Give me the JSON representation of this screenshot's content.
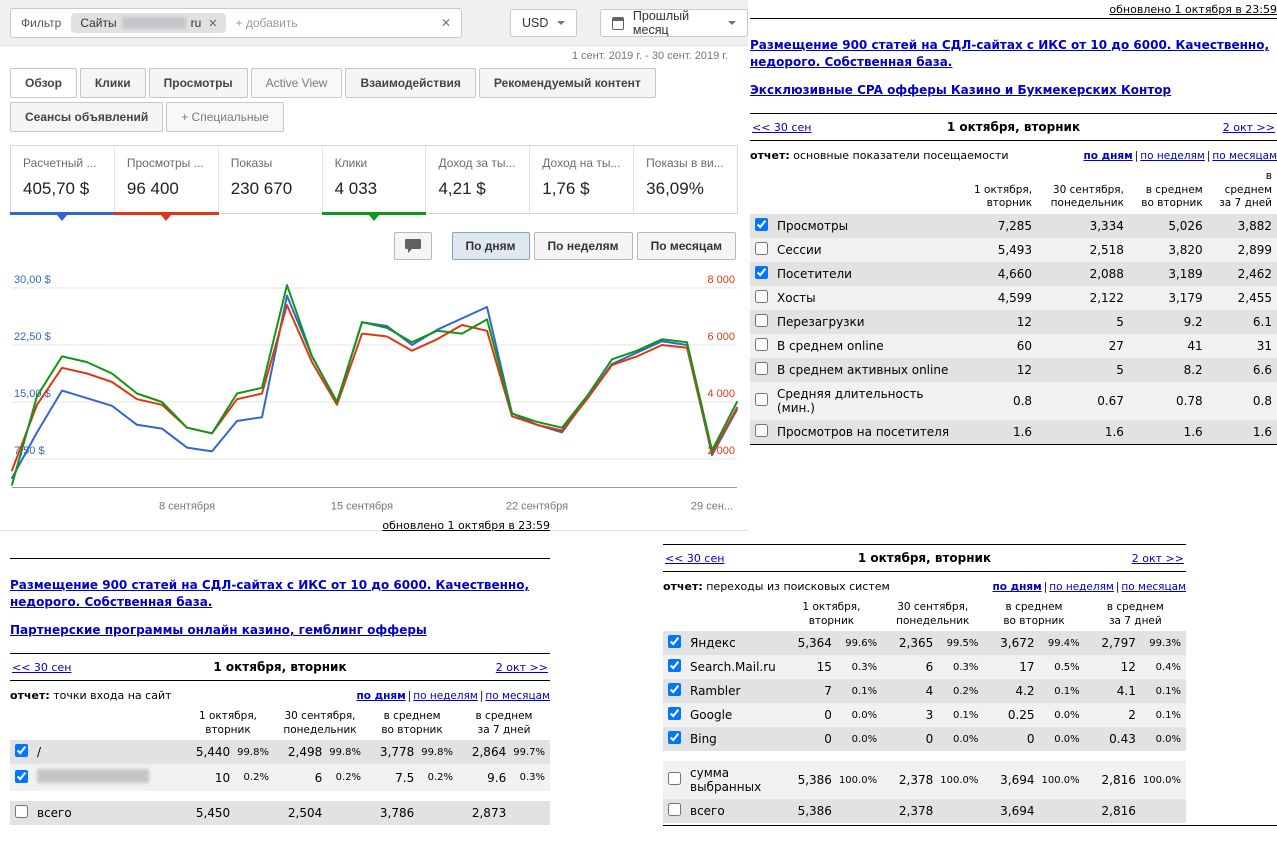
{
  "adsense": {
    "filter_label": "Фильтр",
    "chip_prefix": "Сайты",
    "chip_suffix": "ru",
    "chip_remove": "✕",
    "add_placeholder": "+ добавить",
    "clear_icon": "✕",
    "currency": "USD",
    "period": "Прошлый месяц",
    "date_range": "1 сент. 2019 г. - 30 сент. 2019 г.",
    "tabs_row1": [
      {
        "label": "Обзор",
        "selected": true
      },
      {
        "label": "Клики"
      },
      {
        "label": "Просмотры"
      },
      {
        "label": "Active View",
        "muted": true
      },
      {
        "label": "Взаимодействия"
      },
      {
        "label": "Рекомендуемый контент"
      }
    ],
    "tabs_row2": [
      {
        "label": "Сеансы объявлений"
      },
      {
        "label": "+ Специальные",
        "muted": true
      }
    ],
    "metrics": [
      {
        "label": "Расчетный ...",
        "value": "405,70 $",
        "accent": "#3366cc"
      },
      {
        "label": "Просмотры ...",
        "value": "96 400",
        "accent": "#dc3912"
      },
      {
        "label": "Показы",
        "value": "230 670"
      },
      {
        "label": "Клики",
        "value": "4 033",
        "accent": "#109618"
      },
      {
        "label": "Доход за ты...",
        "value": "4,21 $"
      },
      {
        "label": "Доход на ты...",
        "value": "1,76 $"
      },
      {
        "label": "Показы в ви...",
        "value": "36,09%"
      }
    ],
    "view_buttons": [
      {
        "label": "По дням",
        "selected": true
      },
      {
        "label": "По неделям"
      },
      {
        "label": "По месяцам"
      }
    ]
  },
  "chart_data": {
    "type": "line",
    "x_days": [
      1,
      2,
      3,
      4,
      5,
      6,
      7,
      8,
      9,
      10,
      11,
      12,
      13,
      14,
      15,
      16,
      17,
      18,
      19,
      20,
      21,
      22,
      23,
      24,
      25,
      26,
      27,
      28,
      29,
      30
    ],
    "x_ticks": [
      {
        "day": 8,
        "label": "8 сентября"
      },
      {
        "day": 15,
        "label": "15 сентября"
      },
      {
        "day": 22,
        "label": "22 сентября"
      },
      {
        "day": 29,
        "label": "29 сен..."
      }
    ],
    "left_axis": {
      "unit": "$",
      "ticks": [
        {
          "v": 30,
          "label": "30,00 $"
        },
        {
          "v": 22.5,
          "label": "22,50 $"
        },
        {
          "v": 15,
          "label": "15,00 $"
        },
        {
          "v": 7.5,
          "label": "7,50 $"
        }
      ]
    },
    "right_axis": {
      "ticks": [
        {
          "v": 8000,
          "label": "8 000"
        },
        {
          "v": 6000,
          "label": "6 000"
        },
        {
          "v": 4000,
          "label": "4 000"
        },
        {
          "v": 2000,
          "label": "2 000"
        }
      ]
    },
    "series": [
      {
        "name": "Расчетный ...",
        "axis": "left",
        "color": "#3366cc",
        "values": [
          5,
          11,
          16.5,
          15.5,
          14.5,
          12,
          11.5,
          9,
          8.5,
          12.5,
          13,
          29,
          21,
          15,
          25.5,
          25,
          22.5,
          24.5,
          26,
          27.5,
          13.5,
          12,
          11,
          15.5,
          20,
          21.5,
          23,
          22.5,
          8,
          14
        ]
      },
      {
        "name": "Просмотры ...",
        "axis": "right",
        "color": "#dc3912",
        "values": [
          1600,
          3900,
          5200,
          5000,
          4700,
          4100,
          3900,
          3100,
          2900,
          4100,
          4300,
          7400,
          5400,
          3900,
          6400,
          6300,
          5800,
          6200,
          6700,
          6500,
          3500,
          3200,
          3000,
          4100,
          5300,
          5600,
          6000,
          5900,
          2200,
          3800
        ]
      },
      {
        "name": "Клики",
        "axis": "right",
        "color": "#109618",
        "values": [
          1100,
          4200,
          5600,
          5400,
          5000,
          4300,
          4000,
          3100,
          2900,
          4300,
          4500,
          8100,
          5600,
          4000,
          6800,
          6600,
          6100,
          6500,
          6400,
          6900,
          3600,
          3300,
          3100,
          4200,
          5500,
          5800,
          6200,
          6100,
          2300,
          4000
        ]
      }
    ]
  },
  "left_report": {
    "updated": "обновлено 1 октября в 23:59",
    "ads": [
      "Размещение 900 статей на СДЛ-сайтах с ИКС от 10 до 6000. Качественно, недорого. Собственная база.",
      "Партнерские программы онлайн казино, гемблинг офферы"
    ],
    "nav": {
      "prev": "<< 30 сен",
      "title": "1 октября, вторник",
      "next": "2 окт >>"
    },
    "report_label": "отчет:",
    "report_name": "точки входа на сайт",
    "views": [
      "по дням",
      "по неделям",
      "по месяцам"
    ],
    "views_sep": "|",
    "table": {
      "pct": true,
      "headers": [
        "1 октября,\nвторник",
        "30 сентября,\nпонедельник",
        "в среднем\nво вторник",
        "в среднем\nза 7 дней"
      ],
      "rows": [
        {
          "checked": true,
          "label": "/",
          "values": [
            "5,440",
            "99.8%",
            "2,498",
            "99.8%",
            "3,778",
            "99.8%",
            "2,864",
            "99.7%"
          ]
        },
        {
          "checked": true,
          "label": "",
          "redacted": true,
          "values": [
            "10",
            "0.2%",
            "6",
            "0.2%",
            "7.5",
            "0.2%",
            "9.6",
            "0.3%"
          ]
        },
        {
          "spacer": true
        },
        {
          "checked": false,
          "label": "всего",
          "values": [
            "5,450",
            "",
            "2,504",
            "",
            "3,786",
            "",
            "2,873",
            ""
          ]
        }
      ]
    }
  },
  "right_top": {
    "updated": "обновлено 1 октября в 23:59",
    "ads": [
      "Размещение 900 статей на СДЛ-сайтах с ИКС от 10 до 6000. Качественно, недорого. Собственная база.",
      "Эксклюзивные CPA офферы Казино и Букмекерских Контор"
    ],
    "nav": {
      "prev": "<< 30 сен",
      "title": "1 октября, вторник",
      "next": "2 окт >>"
    },
    "report_label": "отчет:",
    "report_name": "основные показатели посещаемости",
    "views": [
      "по дням",
      "по неделям",
      "по месяцам"
    ],
    "views_sep": "|",
    "table": {
      "pct": false,
      "headers": [
        "1 октября,\nвторник",
        "30 сентября,\nпонедельник",
        "в среднем\nво вторник",
        "в\nсреднем\nза 7 дней"
      ],
      "rows": [
        {
          "checked": true,
          "label": "Просмотры",
          "values": [
            "7,285",
            "3,334",
            "5,026",
            "3,882"
          ]
        },
        {
          "checked": false,
          "label": "Сессии",
          "values": [
            "5,493",
            "2,518",
            "3,820",
            "2,899"
          ]
        },
        {
          "checked": true,
          "label": "Посетители",
          "values": [
            "4,660",
            "2,088",
            "3,189",
            "2,462"
          ]
        },
        {
          "checked": false,
          "label": "Хосты",
          "values": [
            "4,599",
            "2,122",
            "3,179",
            "2,455"
          ]
        },
        {
          "checked": false,
          "label": "Перезагрузки",
          "values": [
            "12",
            "5",
            "9.2",
            "6.1"
          ]
        },
        {
          "checked": false,
          "label": "В среднем online",
          "values": [
            "60",
            "27",
            "41",
            "31"
          ]
        },
        {
          "checked": false,
          "label": "В среднем активных online",
          "values": [
            "12",
            "5",
            "8.2",
            "6.6"
          ]
        },
        {
          "checked": false,
          "label": "Средняя длительность (мин.)",
          "values": [
            "0.8",
            "0.67",
            "0.78",
            "0.8"
          ]
        },
        {
          "checked": false,
          "label": "Просмотров на посетителя",
          "values": [
            "1.6",
            "1.6",
            "1.6",
            "1.6"
          ]
        }
      ]
    }
  },
  "right_bottom": {
    "nav": {
      "prev": "<< 30 сен",
      "title": "1 октября, вторник",
      "next": "2 окт >>"
    },
    "report_label": "отчет:",
    "report_name": "переходы из поисковых систем",
    "views": [
      "по дням",
      "по неделям",
      "по месяцам"
    ],
    "views_sep": "|",
    "table": {
      "pct": true,
      "headers": [
        "1 октября,\nвторник",
        "30 сентября,\nпонедельник",
        "в среднем\nво вторник",
        "в среднем\nза 7 дней"
      ],
      "rows": [
        {
          "checked": true,
          "label": "Яндекс",
          "values": [
            "5,364",
            "99.6%",
            "2,365",
            "99.5%",
            "3,672",
            "99.4%",
            "2,797",
            "99.3%"
          ]
        },
        {
          "checked": true,
          "label": "Search.Mail.ru",
          "values": [
            "15",
            "0.3%",
            "6",
            "0.3%",
            "17",
            "0.5%",
            "12",
            "0.4%"
          ]
        },
        {
          "checked": true,
          "label": "Rambler",
          "values": [
            "7",
            "0.1%",
            "4",
            "0.2%",
            "4.2",
            "0.1%",
            "4.1",
            "0.1%"
          ]
        },
        {
          "checked": true,
          "label": "Google",
          "values": [
            "0",
            "0.0%",
            "3",
            "0.1%",
            "0.25",
            "0.0%",
            "2",
            "0.1%"
          ]
        },
        {
          "checked": true,
          "label": "Bing",
          "values": [
            "0",
            "0.0%",
            "0",
            "0.0%",
            "0",
            "0.0%",
            "0.43",
            "0.0%"
          ]
        },
        {
          "spacer": true
        },
        {
          "checked": false,
          "label": "сумма выбранных",
          "values": [
            "5,386",
            "100.0%",
            "2,378",
            "100.0%",
            "3,694",
            "100.0%",
            "2,816",
            "100.0%"
          ]
        },
        {
          "checked": false,
          "label": "всего",
          "values": [
            "5,386",
            "",
            "2,378",
            "",
            "3,694",
            "",
            "2,816",
            ""
          ]
        }
      ]
    }
  }
}
